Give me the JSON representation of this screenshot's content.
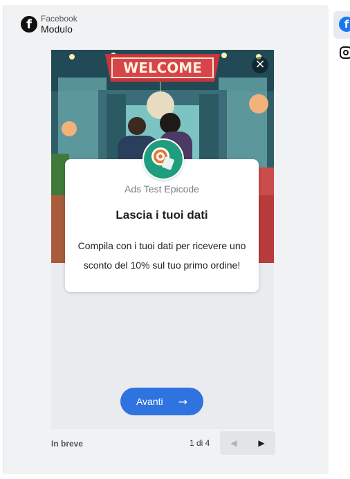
{
  "header": {
    "source": "Facebook",
    "title": "Modulo",
    "logo_icon": "facebook-icon"
  },
  "hero": {
    "banner_text": "WELCOME",
    "close_glyph": "×"
  },
  "card": {
    "company": "Ads Test Epicode",
    "title": "Lascia i tuoi dati",
    "description": "Compila con i tuoi dati per ricevere uno sconto del 10% sul tuo primo ordine!",
    "avatar_icon": "target-logo-icon"
  },
  "next_button": {
    "label": "Avanti",
    "icon": "arrow-right-icon",
    "color": "#2f73e0"
  },
  "footer": {
    "summary": "In breve",
    "page_count": "1 di 4",
    "prev_icon": "chevron-left-icon",
    "next_icon": "chevron-right-icon"
  },
  "platforms": {
    "items": [
      {
        "name": "facebook",
        "icon": "facebook-icon",
        "selected": true
      },
      {
        "name": "instagram",
        "icon": "instagram-icon",
        "selected": false
      }
    ]
  }
}
